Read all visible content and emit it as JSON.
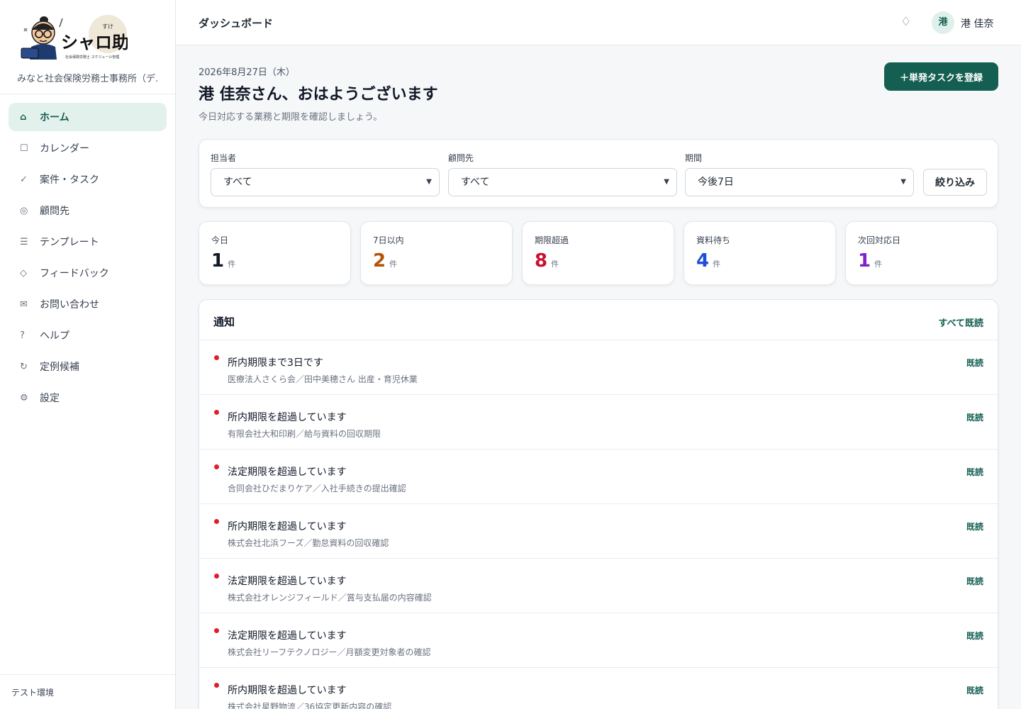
{
  "colors": {
    "accent": "#145f52",
    "accent_bg": "#e3f1ed",
    "alert_dot": "#e11d2f"
  },
  "sidebar": {
    "logo_text": "シャロ助",
    "logo_ruby": "すけ",
    "logo_tagline": "社会保険労務士 スケジュール管理",
    "office_name": "みなと社会保険労務士事務所（デ…",
    "items": [
      {
        "label": "ホーム",
        "icon": "⌂",
        "icon_name": "home-icon"
      },
      {
        "label": "カレンダー",
        "icon": "☐",
        "icon_name": "calendar-icon"
      },
      {
        "label": "案件・タスク",
        "icon": "✓",
        "icon_name": "check-icon"
      },
      {
        "label": "顧問先",
        "icon": "◎",
        "icon_name": "client-icon"
      },
      {
        "label": "テンプレート",
        "icon": "☰",
        "icon_name": "template-icon"
      },
      {
        "label": "フィードバック",
        "icon": "◇",
        "icon_name": "feedback-icon"
      },
      {
        "label": "お問い合わせ",
        "icon": "✉",
        "icon_name": "mail-icon"
      },
      {
        "label": "ヘルプ",
        "icon": "?",
        "icon_name": "help-icon"
      },
      {
        "label": "定例候補",
        "icon": "↻",
        "icon_name": "recurring-icon"
      },
      {
        "label": "設定",
        "icon": "⚙",
        "icon_name": "gear-icon"
      }
    ],
    "footer": "テスト環境"
  },
  "topbar": {
    "title": "ダッシュボード",
    "bell_icon": "♢",
    "avatar": "港",
    "user_name": "港 佳奈"
  },
  "greeting": {
    "date": "2026年8月27日（木）",
    "title": "港 佳奈さん、おはようございます",
    "subtitle": "今日対応する業務と期限を確認しましょう。",
    "button": "＋単発タスクを登録"
  },
  "filters": {
    "assignee": {
      "label": "担当者",
      "value": "すべて"
    },
    "client": {
      "label": "顧問先",
      "value": "すべて"
    },
    "period": {
      "label": "期間",
      "value": "今後7日"
    },
    "button": "絞り込み"
  },
  "stats": [
    {
      "label": "今日",
      "value": "1",
      "unit": "件",
      "color": "#111827"
    },
    {
      "label": "7日以内",
      "value": "2",
      "unit": "件",
      "color": "#b45309"
    },
    {
      "label": "期限超過",
      "value": "8",
      "unit": "件",
      "color": "#c8102e"
    },
    {
      "label": "資料待ち",
      "value": "4",
      "unit": "件",
      "color": "#1d4ed8"
    },
    {
      "label": "次回対応日",
      "value": "1",
      "unit": "件",
      "color": "#7e22ce"
    }
  ],
  "notifications": {
    "title": "通知",
    "mark_all": "すべて既読",
    "read_label": "既読",
    "items": [
      {
        "title": "所内期限まで3日です",
        "sub": "医療法人さくら会／田中美穂さん 出産・育児休業"
      },
      {
        "title": "所内期限を超過しています",
        "sub": "有限会社大和印刷／給与資料の回収期限"
      },
      {
        "title": "法定期限を超過しています",
        "sub": "合同会社ひだまりケア／入社手続きの提出確認"
      },
      {
        "title": "所内期限を超過しています",
        "sub": "株式会社北浜フーズ／勤怠資料の回収確認"
      },
      {
        "title": "法定期限を超過しています",
        "sub": "株式会社オレンジフィールド／賞与支払届の内容確認"
      },
      {
        "title": "法定期限を超過しています",
        "sub": "株式会社リーフテクノロジー／月額変更対象者の確認"
      },
      {
        "title": "所内期限を超過しています",
        "sub": "株式会社星野物流／36協定更新内容の確認"
      }
    ]
  }
}
